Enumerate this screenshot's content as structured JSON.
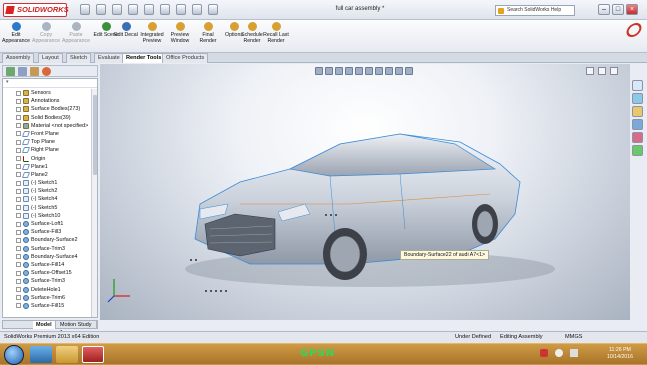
{
  "window": {
    "app_name": "SOLIDWORKS",
    "title": "full car assembly *",
    "search_placeholder": "Search SolidWorks Help"
  },
  "ribbon": {
    "buttons": [
      {
        "label": "Edit Appearance",
        "disabled": false,
        "color": "#2a7cc8"
      },
      {
        "label": "Copy Appearance",
        "disabled": true,
        "color": "#aab4c2"
      },
      {
        "label": "Paste Appearance",
        "disabled": true,
        "color": "#aab4c2"
      },
      {
        "label": "Edit Scene",
        "disabled": false,
        "color": "#3c8f3c"
      },
      {
        "label": "Edit Decal",
        "disabled": false,
        "color": "#3a6fb4"
      },
      {
        "label": "Integrated Preview",
        "disabled": false,
        "color": "#d8a030"
      },
      {
        "label": "Preview Window",
        "disabled": false,
        "color": "#d8a030"
      },
      {
        "label": "Final Render",
        "disabled": false,
        "color": "#d8a030"
      },
      {
        "label": "Options",
        "disabled": false,
        "color": "#d8a030"
      },
      {
        "label": "Schedule Render",
        "disabled": false,
        "color": "#d8a030"
      },
      {
        "label": "Recall Last Render",
        "disabled": false,
        "color": "#d8a030"
      }
    ]
  },
  "tabs": [
    "Assembly",
    "Layout",
    "Sketch",
    "Evaluate",
    "Render Tools",
    "Office Products"
  ],
  "active_tab": "Render Tools",
  "feature_tree": {
    "items": [
      {
        "label": "Sensors",
        "kind": "folder"
      },
      {
        "label": "Annotations",
        "kind": "folder"
      },
      {
        "label": "Surface Bodies(273)",
        "kind": "folder"
      },
      {
        "label": "Solid Bodies(39)",
        "kind": "folder"
      },
      {
        "label": "Material <not specified>",
        "kind": "mate"
      },
      {
        "label": "Front Plane",
        "kind": "plane"
      },
      {
        "label": "Top Plane",
        "kind": "plane"
      },
      {
        "label": "Right Plane",
        "kind": "plane"
      },
      {
        "label": "Origin",
        "kind": "origin"
      },
      {
        "label": "Plane1",
        "kind": "plane"
      },
      {
        "label": "Plane2",
        "kind": "plane"
      },
      {
        "label": "(-) Sketch1",
        "kind": "sketch"
      },
      {
        "label": "(-) Sketch2",
        "kind": "sketch"
      },
      {
        "label": "(-) Sketch4",
        "kind": "sketch"
      },
      {
        "label": "(-) Sketch5",
        "kind": "sketch"
      },
      {
        "label": "(-) Sketch10",
        "kind": "sketch"
      },
      {
        "label": "Surface-Loft1",
        "kind": "surf"
      },
      {
        "label": "Surface-Fill3",
        "kind": "surf"
      },
      {
        "label": "Boundary-Surface2",
        "kind": "surf"
      },
      {
        "label": "Surface-Trim3",
        "kind": "surf"
      },
      {
        "label": "Boundary-Surface4",
        "kind": "surf"
      },
      {
        "label": "Surface-Fill14",
        "kind": "surf"
      },
      {
        "label": "Surface-Offset15",
        "kind": "surf"
      },
      {
        "label": "Surface-Trim3",
        "kind": "surf"
      },
      {
        "label": "DeleteHole1",
        "kind": "surf"
      },
      {
        "label": "Surface-Trim6",
        "kind": "surf"
      },
      {
        "label": "Surface-Fill15",
        "kind": "surf"
      }
    ]
  },
  "bottom_tabs": [
    "Model",
    "Motion Study 1"
  ],
  "tooltip": "Boundary-Surface22 of audi A7<1>",
  "status": {
    "version": "SolidWorks Premium 2013 x64 Edition",
    "definition": "Under Defined",
    "mode": "Editing Assembly",
    "units": "MMGS"
  },
  "taskbar": {
    "brand": "GPSN",
    "time": "11:26 PM",
    "date": "10/14/2016"
  }
}
